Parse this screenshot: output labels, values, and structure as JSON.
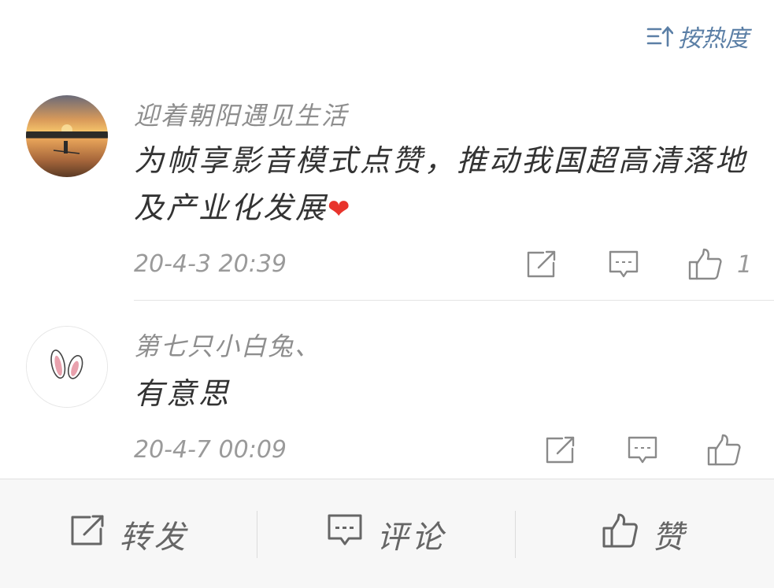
{
  "sort": {
    "label": "按热度",
    "icon": "sort-up-icon",
    "color": "#5b7fa6"
  },
  "comments": [
    {
      "username": "迎着朝阳遇见生活",
      "content": "为帧享影音模式点赞，推动我国超高清落地及产业化发展",
      "emoji": "❤",
      "timestamp": "20-4-3 20:39",
      "like_count": "1",
      "avatar": "sunrise-lake-avatar"
    },
    {
      "username": "第七只小白兔、",
      "content": "有意思",
      "timestamp": "20-4-7 00:09",
      "like_count": "",
      "avatar": "bunny-ears-avatar"
    }
  ],
  "bottom_bar": {
    "share_label": "转发",
    "comment_label": "评论",
    "like_label": "赞"
  },
  "colors": {
    "heart": "#e8342c",
    "text_primary": "#333333",
    "text_secondary": "#9a9a9a",
    "bar_bg": "#f7f7f7"
  }
}
